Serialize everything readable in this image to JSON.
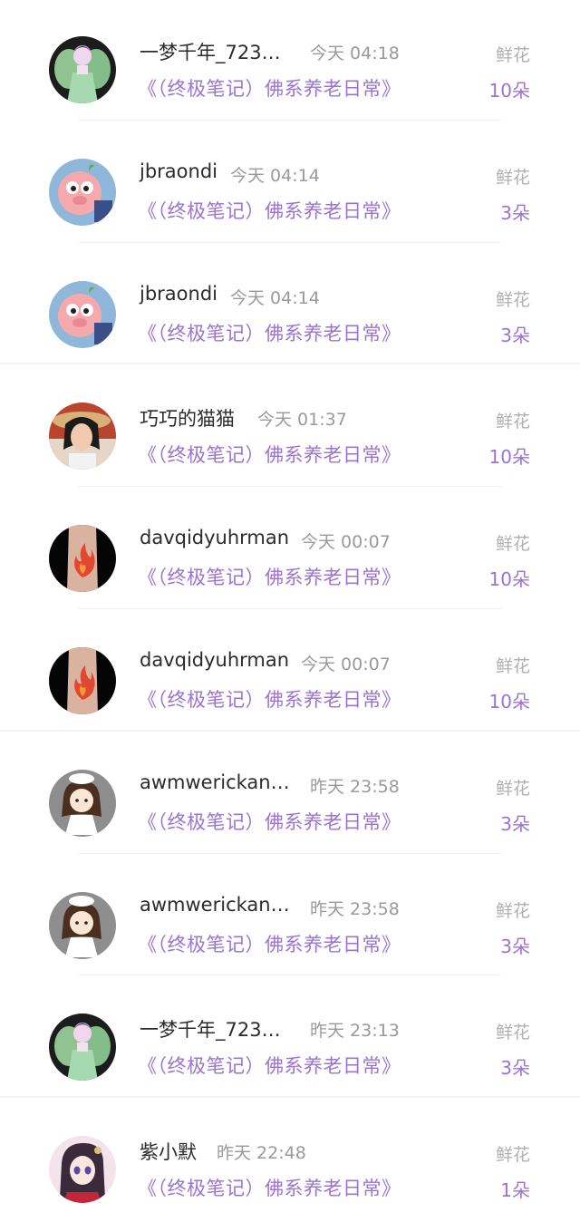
{
  "gifts": [
    {
      "name": "一梦千年_723…",
      "time": "今天 04:18",
      "book": "《（终极笔记）佛系养老日常》",
      "gift": "鲜花",
      "count": "10朵",
      "avatar": "fairy-avatar-icon"
    },
    {
      "name": "jbraondi",
      "time": "今天 04:14",
      "book": "《（终极笔记）佛系养老日常》",
      "gift": "鲜花",
      "count": "3朵",
      "avatar": "cartoon-pig-avatar-icon"
    },
    {
      "name": "jbraondi",
      "time": "今天 04:14",
      "book": "《（终极笔记）佛系养老日常》",
      "gift": "鲜花",
      "count": "3朵",
      "avatar": "cartoon-pig-avatar-icon"
    },
    {
      "name": "巧巧的猫猫",
      "time": "今天 01:37",
      "book": "《（终极笔记）佛系养老日常》",
      "gift": "鲜花",
      "count": "10朵",
      "avatar": "woman-hat-avatar-icon"
    },
    {
      "name": "davqidyuhrman",
      "time": "今天 00:07",
      "book": "《（终极笔记）佛系养老日常》",
      "gift": "鲜花",
      "count": "10朵",
      "avatar": "flame-tattoo-avatar-icon"
    },
    {
      "name": "davqidyuhrman",
      "time": "今天 00:07",
      "book": "《（终极笔记）佛系养老日常》",
      "gift": "鲜花",
      "count": "10朵",
      "avatar": "flame-tattoo-avatar-icon"
    },
    {
      "name": "awmwerickan…",
      "time": "昨天 23:58",
      "book": "《（终极笔记）佛系养老日常》",
      "gift": "鲜花",
      "count": "3朵",
      "avatar": "cartoon-girl-avatar-icon"
    },
    {
      "name": "awmwerickan…",
      "time": "昨天 23:58",
      "book": "《（终极笔记）佛系养老日常》",
      "gift": "鲜花",
      "count": "3朵",
      "avatar": "cartoon-girl-avatar-icon"
    },
    {
      "name": "一梦千年_723…",
      "time": "昨天 23:13",
      "book": "《（终极笔记）佛系养老日常》",
      "gift": "鲜花",
      "count": "3朵",
      "avatar": "fairy-avatar-icon"
    },
    {
      "name": "紫小默",
      "time": "昨天 22:48",
      "book": "《（终极笔记）佛系养老日常》",
      "gift": "鲜花",
      "count": "1朵",
      "avatar": "anime-girl-avatar-icon"
    }
  ],
  "colors": {
    "accent": "#9b74d0",
    "name": "#2b2b2b",
    "muted": "#9a9a9a",
    "gift_label": "#b0b0b0"
  }
}
